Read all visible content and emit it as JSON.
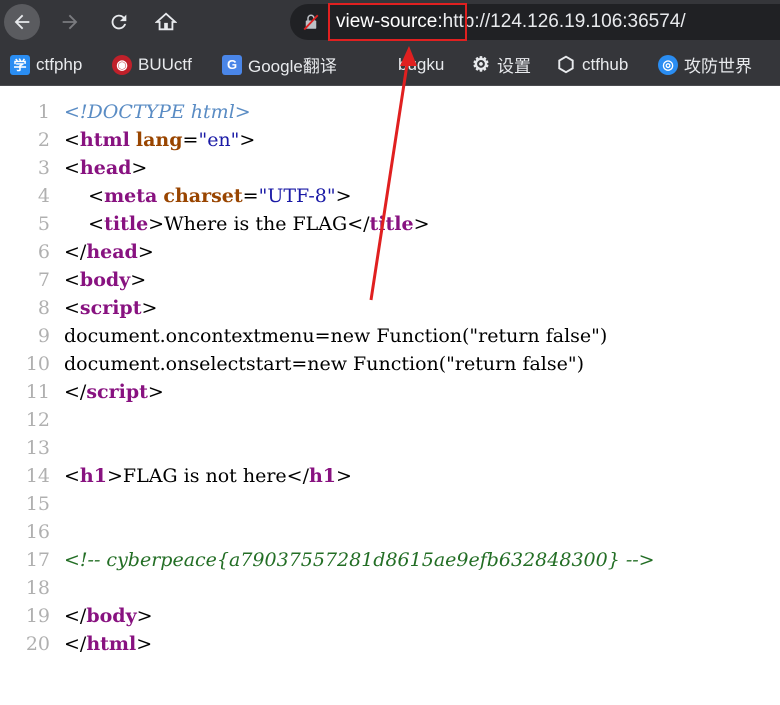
{
  "browser": {
    "url_prefix": "view-source:",
    "url_rest": "http://124.126.19.106:36574/",
    "colors": {
      "highlight": "#e02020",
      "toolbar": "#35363a"
    }
  },
  "bookmarks": [
    {
      "label": "ctfphp",
      "icon": "book-icon",
      "icon_char": "学",
      "color": "#2a8df2"
    },
    {
      "label": "BUUctf",
      "icon": "flame-icon",
      "icon_char": "◉",
      "color": "#c0202a"
    },
    {
      "label": "Google翻译",
      "icon": "translate-icon",
      "icon_char": "G",
      "color": "#4a86e8"
    },
    {
      "label": "bugku",
      "icon": "",
      "icon_char": "",
      "color": ""
    },
    {
      "label": "设置",
      "icon": "gear-icon",
      "icon_char": "⚙",
      "color": ""
    },
    {
      "label": "ctfhub",
      "icon": "hex-icon",
      "icon_char": "⬡",
      "color": ""
    },
    {
      "label": "攻防世界",
      "icon": "globe-icon",
      "icon_char": "◎",
      "color": "#2a8df2"
    }
  ],
  "source": {
    "line_numbers": [
      "1",
      "2",
      "3",
      "4",
      "5",
      "6",
      "7",
      "8",
      "9",
      "10",
      "11",
      "12",
      "13",
      "14",
      "15",
      "16",
      "17",
      "18",
      "19",
      "20"
    ],
    "l1": "<!DOCTYPE html>",
    "l2_tag": "html",
    "l2_attr": "lang",
    "l2_val": "\"en\"",
    "l3_tag": "head",
    "l4_tag": "meta",
    "l4_attr": "charset",
    "l4_val": "\"UTF-8\"",
    "l5_tag": "title",
    "l5_text": "Where is the FLAG",
    "l6_tag": "head",
    "l7_tag": "body",
    "l8_tag": "script",
    "l9": "document.oncontextmenu=new Function(\"return false\")",
    "l10": "document.onselectstart=new Function(\"return false\")",
    "l11_tag": "script",
    "l14_tag": "h1",
    "l14_text": "FLAG is not here",
    "l17": "<!-- cyberpeace{a79037557281d8615ae9efb632848300} -->",
    "l19_tag": "body",
    "l20_tag": "html"
  }
}
